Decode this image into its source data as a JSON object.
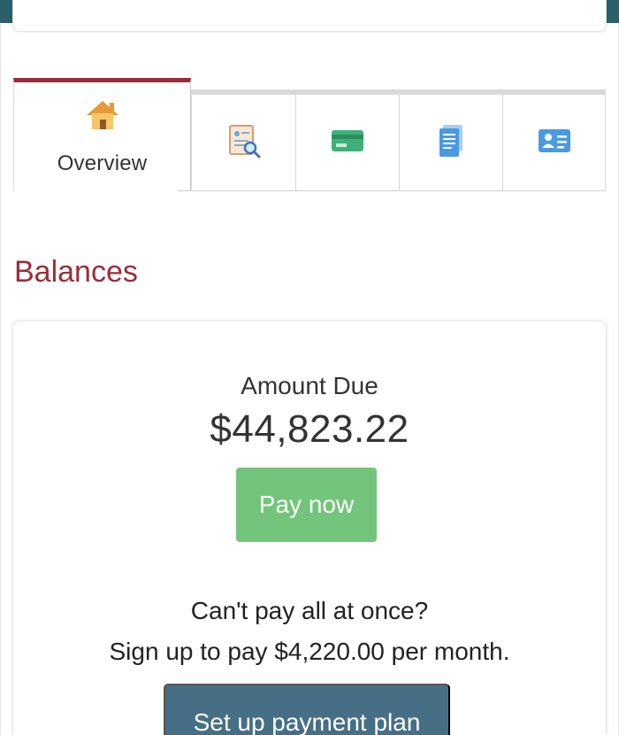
{
  "tabs": [
    {
      "label": "Overview",
      "icon": "home-icon",
      "active": true
    },
    {
      "label": "",
      "icon": "document-search-icon",
      "active": false
    },
    {
      "label": "",
      "icon": "credit-card-icon",
      "active": false
    },
    {
      "label": "",
      "icon": "document-list-icon",
      "active": false
    },
    {
      "label": "",
      "icon": "id-card-icon",
      "active": false
    }
  ],
  "balances": {
    "title": "Balances",
    "amount_label": "Amount Due",
    "amount": "$44,823.22",
    "pay_label": "Pay now",
    "cant_pay_text": "Can't pay all at once?",
    "signup_text": "Sign up to pay $4,220.00 per month.",
    "plan_button_label": "Set up payment plan"
  },
  "colors": {
    "header": "#2d5f6b",
    "accent": "#9b2d3a",
    "pay_button": "#72c57a",
    "plan_button": "#466f85"
  }
}
